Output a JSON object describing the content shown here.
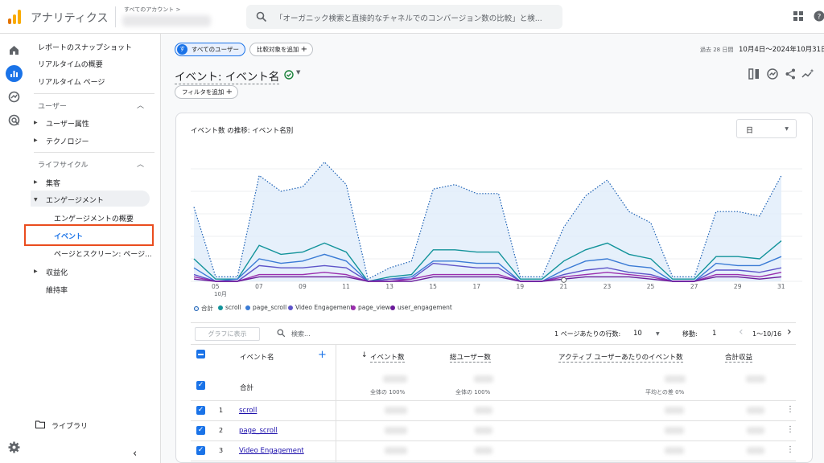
{
  "header": {
    "app_name": "アナリティクス",
    "account_label": "すべてのアカウント >",
    "search_placeholder": "「オーガニック検索と直接的なチャネルでのコンバージョン数の比較」と検..."
  },
  "nav": {
    "items": [
      "レポートのスナップショット",
      "リアルタイムの概要",
      "リアルタイム ページ"
    ],
    "section_user": "ユーザー",
    "user_items": [
      "ユーザー属性",
      "テクノロジー"
    ],
    "section_lifecycle": "ライフサイクル",
    "lifecycle_acq": "集客",
    "lifecycle_eng": "エンゲージメント",
    "eng_sub": [
      "エンゲージメントの概要",
      "イベント",
      "ページとスクリーン: ページ..."
    ],
    "monetization": "収益化",
    "retention": "維持率",
    "library": "ライブラリ"
  },
  "toolbar": {
    "all_users": "すべてのユーザー",
    "all_users_avatar": "す",
    "add_comparison": "比較対象を追加",
    "date_range_label": "過去 28 日間",
    "date_range": "10月4日～2024年10月31日",
    "page_title": "イベント: イベント名",
    "add_filter": "フィルタを追加"
  },
  "chart": {
    "title": "イベント数 の推移: イベント名別",
    "granularity": "日",
    "x_ticks": [
      "05",
      "07",
      "09",
      "11",
      "13",
      "15",
      "17",
      "19",
      "21",
      "23",
      "25",
      "27",
      "29",
      "31"
    ],
    "month_label": "10月",
    "legend": [
      "合計",
      "scroll",
      "page_scroll",
      "Video Engagement",
      "page_view",
      "user_engagement"
    ]
  },
  "chart_data": {
    "type": "line",
    "x": [
      "10/4",
      "10/5",
      "10/6",
      "10/7",
      "10/8",
      "10/9",
      "10/10",
      "10/11",
      "10/12",
      "10/13",
      "10/14",
      "10/15",
      "10/16",
      "10/17",
      "10/18",
      "10/19",
      "10/20",
      "10/21",
      "10/22",
      "10/23",
      "10/24",
      "10/25",
      "10/26",
      "10/27",
      "10/28",
      "10/29",
      "10/30",
      "10/31"
    ],
    "series": [
      {
        "name": "合計",
        "color": "#1a5fb4",
        "values": [
          33,
          2,
          2,
          47,
          40,
          42,
          53,
          43,
          1,
          6,
          9,
          41,
          43,
          39,
          39,
          2,
          2,
          24,
          38,
          45,
          31,
          26,
          2,
          2,
          31,
          31,
          29,
          47
        ]
      },
      {
        "name": "scroll",
        "color": "#12939a",
        "values": [
          10,
          1,
          1,
          16,
          12,
          13,
          17,
          13,
          0,
          2,
          3,
          14,
          14,
          13,
          13,
          1,
          1,
          9,
          14,
          17,
          12,
          10,
          1,
          1,
          11,
          11,
          10,
          18
        ]
      },
      {
        "name": "page_scroll",
        "color": "#3a7bd5",
        "values": [
          6,
          0,
          1,
          10,
          8,
          9,
          12,
          9,
          0,
          1,
          2,
          9,
          9,
          8,
          8,
          0,
          0,
          5,
          9,
          10,
          7,
          6,
          0,
          0,
          8,
          7,
          7,
          11
        ]
      },
      {
        "name": "Video Engagement",
        "color": "#5e54c9",
        "values": [
          3,
          0,
          0,
          7,
          6,
          6,
          7,
          6,
          0,
          1,
          1,
          8,
          7,
          6,
          6,
          0,
          0,
          3,
          5,
          6,
          4,
          3,
          0,
          0,
          5,
          5,
          4,
          6
        ]
      },
      {
        "name": "page_view",
        "color": "#9b2fae",
        "values": [
          2,
          0,
          0,
          3,
          3,
          3,
          4,
          3,
          0,
          0,
          1,
          3,
          3,
          3,
          3,
          0,
          0,
          2,
          3,
          4,
          3,
          2,
          0,
          0,
          3,
          3,
          2,
          4
        ]
      },
      {
        "name": "user_engagement",
        "color": "#6a1b9a",
        "values": [
          1,
          0,
          0,
          2,
          2,
          2,
          2,
          2,
          0,
          0,
          0,
          2,
          2,
          2,
          2,
          0,
          0,
          1,
          2,
          2,
          2,
          1,
          0,
          0,
          2,
          2,
          1,
          2
        ]
      }
    ]
  },
  "table": {
    "show_in_chart": "グラフに表示",
    "search_placeholder": "検索...",
    "rows_per_page_label": "1 ページあたりの行数:",
    "rows_per_page": "10",
    "goto_label": "移動:",
    "goto_value": "1",
    "pagination": "1～10/16",
    "columns": [
      "イベント名",
      "イベント数",
      "総ユーザー数",
      "アクティブ ユーザーあたりのイベント数",
      "合計収益"
    ],
    "total_label": "合計",
    "total_pct_events": "全体の 100%",
    "total_pct_users": "全体の 100%",
    "total_avg_diff": "平均との差 0%",
    "rows": [
      {
        "num": "1",
        "name": "scroll"
      },
      {
        "num": "2",
        "name": "page_scroll"
      },
      {
        "num": "3",
        "name": "Video Engagement"
      }
    ]
  }
}
